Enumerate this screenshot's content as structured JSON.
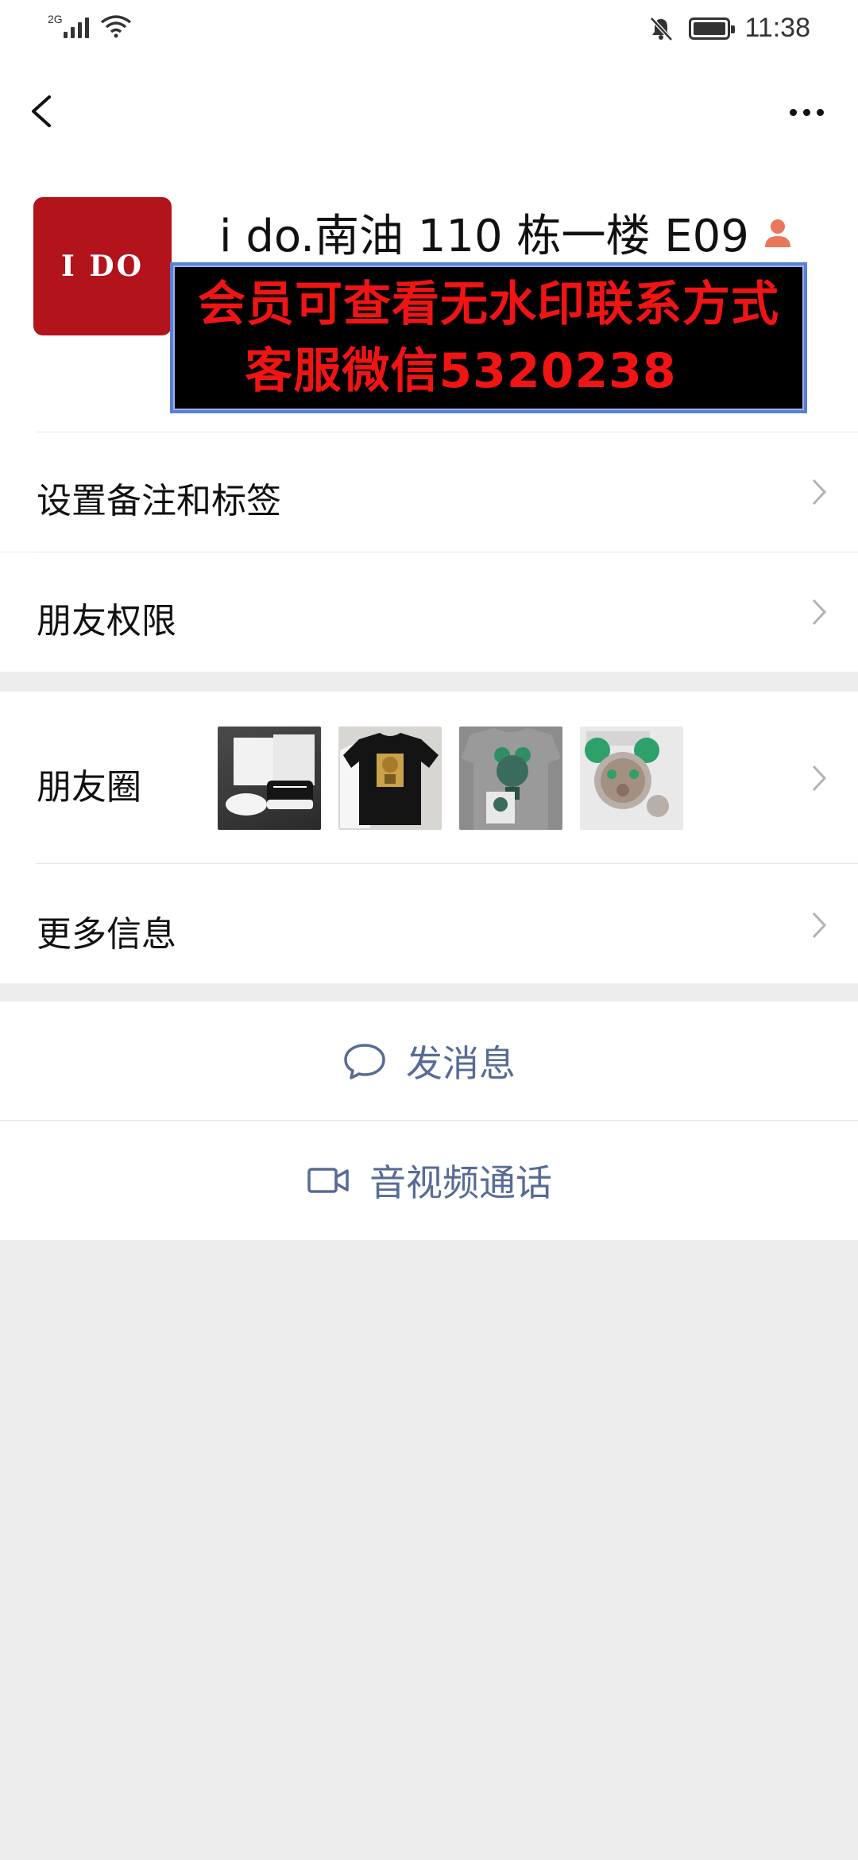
{
  "status_bar": {
    "network": "2G",
    "time": "11:38"
  },
  "profile": {
    "avatar_text": "I DO",
    "name": "i do.南油 110 栋一楼 E09",
    "watermark_line1": "会员可查看无水印联系方式",
    "watermark_line2": "客服微信5320238"
  },
  "menu": {
    "remarks_tags": "设置备注和标签",
    "friend_permissions": "朋友权限",
    "moments": "朋友圈",
    "more_info": "更多信息"
  },
  "actions": {
    "send_message": "发消息",
    "video_call": "音视频通话"
  },
  "colors": {
    "link_blue": "#576b95",
    "avatar_red": "#b3131b",
    "watermark_red": "#f01414",
    "page_gray": "#ededed"
  }
}
